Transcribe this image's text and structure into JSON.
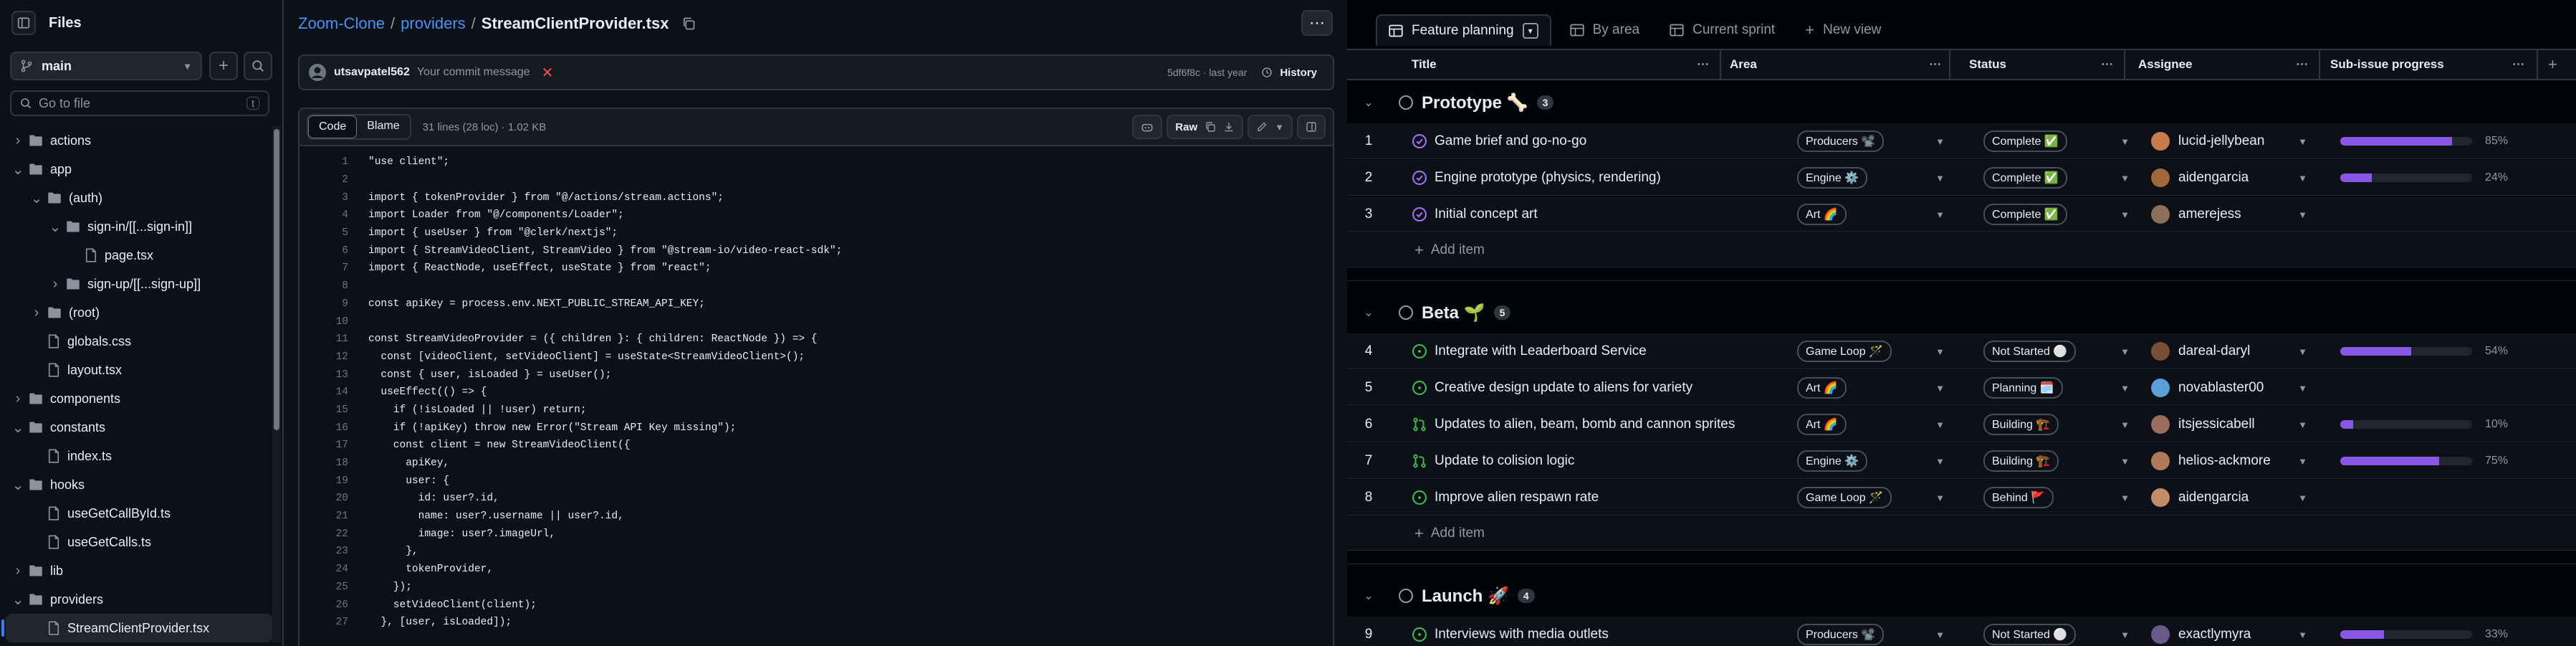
{
  "files": {
    "title": "Files",
    "branch": "main",
    "search_placeholder": "Go to file",
    "search_kbd": "t",
    "tree": [
      {
        "label": "actions",
        "type": "folder",
        "depth": 0,
        "open": false
      },
      {
        "label": "app",
        "type": "folder",
        "depth": 0,
        "open": true
      },
      {
        "label": "(auth)",
        "type": "folder",
        "depth": 1,
        "open": true
      },
      {
        "label": "sign-in/[[...sign-in]]",
        "type": "folder",
        "depth": 2,
        "open": true
      },
      {
        "label": "page.tsx",
        "type": "file",
        "depth": 3
      },
      {
        "label": "sign-up/[[...sign-up]]",
        "type": "folder",
        "depth": 2,
        "open": false
      },
      {
        "label": "(root)",
        "type": "folder",
        "depth": 1,
        "open": false
      },
      {
        "label": "globals.css",
        "type": "file",
        "depth": 1
      },
      {
        "label": "layout.tsx",
        "type": "file",
        "depth": 1
      },
      {
        "label": "components",
        "type": "folder",
        "depth": 0,
        "open": false
      },
      {
        "label": "constants",
        "type": "folder",
        "depth": 0,
        "open": true
      },
      {
        "label": "index.ts",
        "type": "file",
        "depth": 1
      },
      {
        "label": "hooks",
        "type": "folder",
        "depth": 0,
        "open": true
      },
      {
        "label": "useGetCallById.ts",
        "type": "file",
        "depth": 1
      },
      {
        "label": "useGetCalls.ts",
        "type": "file",
        "depth": 1
      },
      {
        "label": "lib",
        "type": "folder",
        "depth": 0,
        "open": false
      },
      {
        "label": "providers",
        "type": "folder",
        "depth": 0,
        "open": true
      },
      {
        "label": "StreamClientProvider.tsx",
        "type": "file",
        "depth": 1,
        "selected": true
      }
    ]
  },
  "code": {
    "breadcrumb": {
      "repo": "Zoom-Clone",
      "sep": "/",
      "folder": "providers",
      "file": "StreamClientProvider.tsx"
    },
    "commit": {
      "author": "utsavpatel562",
      "message": "Your commit message",
      "sha_time": "5df6f8c · last year",
      "history_label": "History"
    },
    "toolbar": {
      "code_tab": "Code",
      "blame_tab": "Blame",
      "meta": "31 lines (28 loc) · 1.02 KB",
      "raw_label": "Raw"
    },
    "lines": [
      "\"use client\";",
      "",
      "import { tokenProvider } from \"@/actions/stream.actions\";",
      "import Loader from \"@/components/Loader\";",
      "import { useUser } from \"@clerk/nextjs\";",
      "import { StreamVideoClient, StreamVideo } from \"@stream-io/video-react-sdk\";",
      "import { ReactNode, useEffect, useState } from \"react\";",
      "",
      "const apiKey = process.env.NEXT_PUBLIC_STREAM_API_KEY;",
      "",
      "const StreamVideoProvider = ({ children }: { children: ReactNode }) => {",
      "  const [videoClient, setVideoClient] = useState<StreamVideoClient>();",
      "  const { user, isLoaded } = useUser();",
      "  useEffect(() => {",
      "    if (!isLoaded || !user) return;",
      "    if (!apiKey) throw new Error(\"Stream API Key missing\");",
      "    const client = new StreamVideoClient({",
      "      apiKey,",
      "      user: {",
      "        id: user?.id,",
      "        name: user?.username || user?.id,",
      "        image: user?.imageUrl,",
      "      },",
      "      tokenProvider,",
      "    });",
      "    setVideoClient(client);",
      "  }, [user, isLoaded]);"
    ]
  },
  "project": {
    "tabs": [
      {
        "label": "Feature planning",
        "active": true
      },
      {
        "label": "By area",
        "active": false
      },
      {
        "label": "Current sprint",
        "active": false
      },
      {
        "label": "New view",
        "active": false
      }
    ],
    "columns": {
      "title": "Title",
      "area": "Area",
      "status": "Status",
      "assignee": "Assignee",
      "progress": "Sub-issue progress"
    },
    "add_item_label": "Add item",
    "groups": [
      {
        "name": "Prototype 🦴",
        "count": "3",
        "items": [
          {
            "n": "1",
            "title": "Game brief and go-no-go",
            "icon": "done",
            "area": "Producers 📽️",
            "status": "Complete ✅",
            "assignee": "lucid-jellybean",
            "progress": 0.85,
            "pct": "85%"
          },
          {
            "n": "2",
            "title": "Engine prototype (physics, rendering)",
            "icon": "done",
            "area": "Engine ⚙️",
            "status": "Complete ✅",
            "assignee": "aidengarcia",
            "progress": 0.24,
            "pct": "24%"
          },
          {
            "n": "3",
            "title": "Initial concept art",
            "icon": "done",
            "area": "Art 🌈",
            "status": "Complete ✅",
            "assignee": "amerejess",
            "progress": null,
            "pct": ""
          }
        ]
      },
      {
        "name": "Beta 🌱",
        "count": "5",
        "items": [
          {
            "n": "4",
            "title": "Integrate with Leaderboard Service",
            "icon": "open",
            "area": "Game Loop 🪄",
            "status": "Not Started ⚪",
            "assignee": "dareal-daryl",
            "progress": 0.54,
            "pct": "54%"
          },
          {
            "n": "5",
            "title": "Creative design update to aliens for variety",
            "icon": "open",
            "area": "Art 🌈",
            "status": "Planning 🗓️",
            "assignee": "novablaster00",
            "progress": null,
            "pct": ""
          },
          {
            "n": "6",
            "title": "Updates to alien, beam, bomb and cannon sprites",
            "icon": "pr",
            "area": "Art 🌈",
            "status": "Building 🏗️",
            "assignee": "itsjessicabell",
            "progress": 0.1,
            "pct": "10%"
          },
          {
            "n": "7",
            "title": "Update to colision logic",
            "icon": "pr",
            "area": "Engine ⚙️",
            "status": "Building 🏗️",
            "assignee": "helios-ackmore",
            "progress": 0.75,
            "pct": "75%"
          },
          {
            "n": "8",
            "title": "Improve alien respawn rate",
            "icon": "open",
            "area": "Game Loop 🪄",
            "status": "Behind 🚩",
            "assignee": "aidengarcia",
            "progress": null,
            "pct": ""
          }
        ]
      },
      {
        "name": "Launch 🚀",
        "count": "4",
        "items": [
          {
            "n": "9",
            "title": "Interviews with media outlets",
            "icon": "open",
            "area": "Producers 📽️",
            "status": "Not Started ⚪",
            "assignee": "exactlymyra",
            "progress": 0.33,
            "pct": "33%"
          }
        ]
      }
    ]
  }
}
